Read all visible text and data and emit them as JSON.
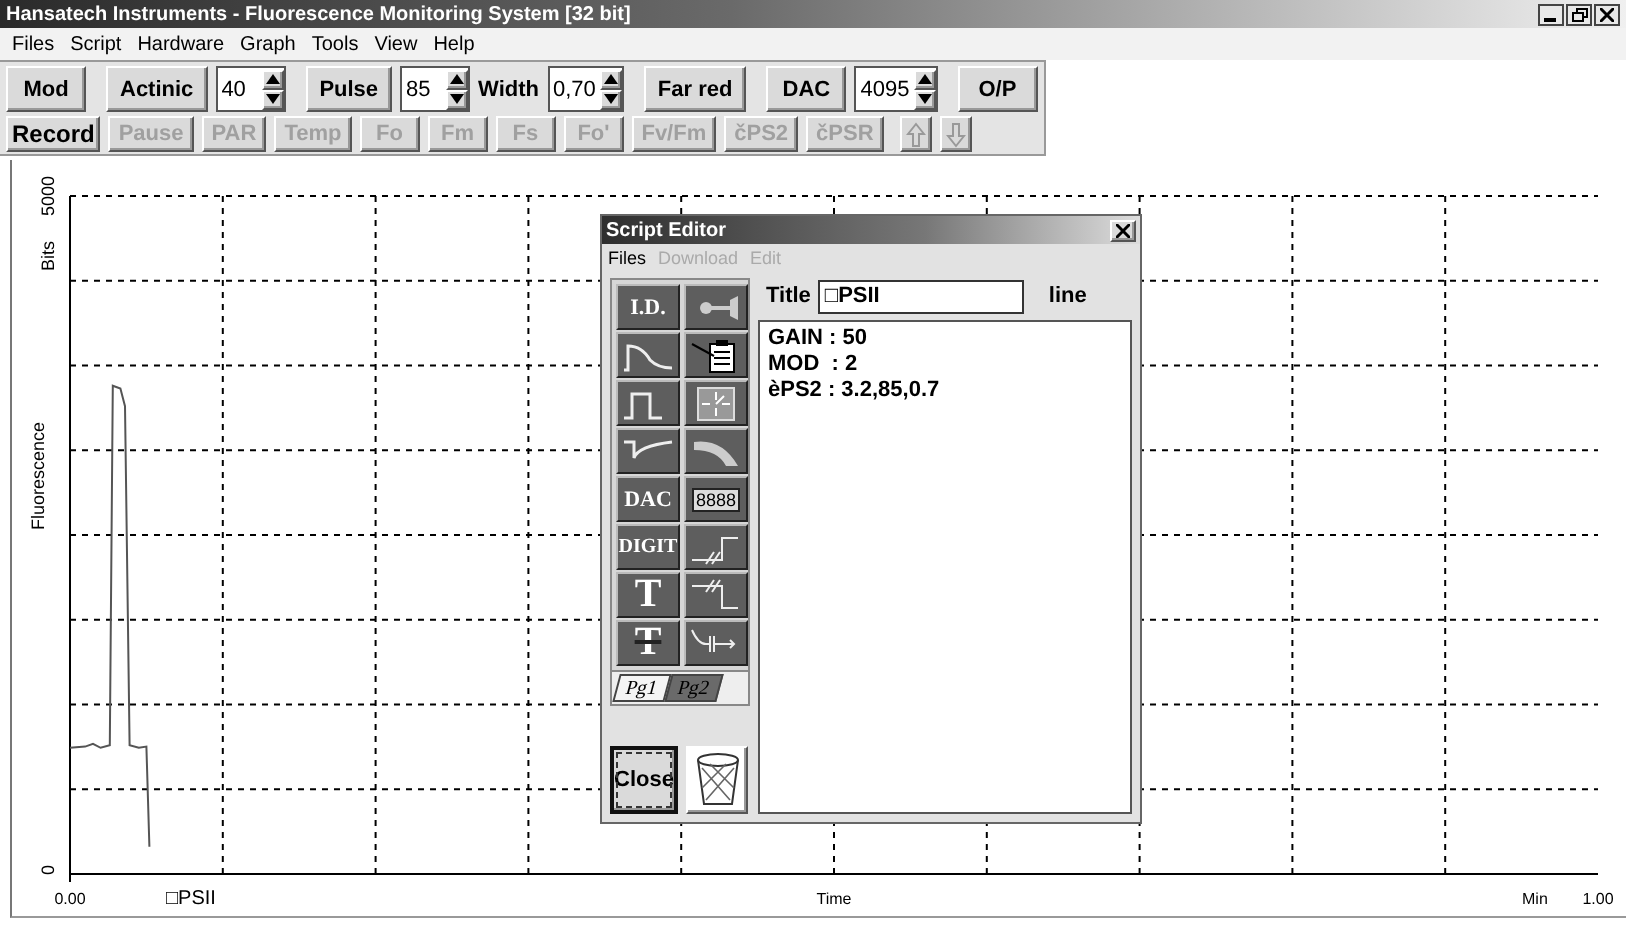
{
  "window": {
    "title": "Hansatech Instruments  -  Fluorescence Monitoring System [32 bit]"
  },
  "menu": [
    "Files",
    "Script",
    "Hardware",
    "Graph",
    "Tools",
    "View",
    "Help"
  ],
  "toolbar_top": [
    {
      "kind": "button",
      "label": "Mod"
    },
    {
      "kind": "spinner",
      "label": "Actinic",
      "value": "40"
    },
    {
      "kind": "spinner",
      "label": "Pulse",
      "value": "85"
    },
    {
      "kind": "labeled-spinner",
      "label": "Width",
      "value": "0,70"
    },
    {
      "kind": "button",
      "label": "Far red"
    },
    {
      "kind": "spinner",
      "label": "DAC",
      "value": "4095"
    },
    {
      "kind": "button",
      "label": "O/P"
    }
  ],
  "toolbar_bottom": [
    {
      "kind": "button",
      "label": "Record",
      "disabled": false
    },
    {
      "kind": "button",
      "label": "Pause",
      "disabled": true
    },
    {
      "kind": "button",
      "label": "PAR",
      "disabled": true
    },
    {
      "kind": "button",
      "label": "Temp",
      "disabled": true
    },
    {
      "kind": "button",
      "label": "Fo",
      "disabled": true
    },
    {
      "kind": "button",
      "label": "Fm",
      "disabled": true
    },
    {
      "kind": "button",
      "label": "Fs",
      "disabled": true
    },
    {
      "kind": "button",
      "label": "Fo'",
      "disabled": true
    },
    {
      "kind": "button",
      "label": "Fv/Fm",
      "disabled": true
    },
    {
      "kind": "button",
      "label": "čPS2",
      "disabled": true
    },
    {
      "kind": "button",
      "label": "čPSR",
      "disabled": true
    },
    {
      "kind": "arrow-up",
      "disabled": true
    },
    {
      "kind": "arrow-down",
      "disabled": true
    }
  ],
  "chart": {
    "x_unit": "Min",
    "y_unit": "Bits",
    "chart_data": {
      "type": "line",
      "xlabel": "Time",
      "ylabel": "Fluorescence",
      "xlim": [
        0,
        1
      ],
      "ylim": [
        0,
        5000
      ],
      "xticks": [
        {
          "value": 0,
          "label": "0.00"
        },
        {
          "value": 1,
          "label": "1.00"
        }
      ],
      "yticks": [
        {
          "value": 0,
          "label": "0"
        },
        {
          "value": 5000,
          "label": "5000"
        }
      ],
      "x": [
        0,
        0.01,
        0.015,
        0.02,
        0.026,
        0.028,
        0.033,
        0.036,
        0.039,
        0.045,
        0.05,
        0.052
      ],
      "series": [
        {
          "name": "□PSII",
          "color": "#555555",
          "values": [
            930,
            940,
            960,
            930,
            950,
            3600,
            3580,
            3450,
            950,
            930,
            940,
            200
          ]
        }
      ]
    }
  },
  "script_editor": {
    "title": "Script Editor",
    "menu": [
      {
        "label": "Files",
        "disabled": false
      },
      {
        "label": "Download",
        "disabled": true
      },
      {
        "label": "Edit",
        "disabled": true
      }
    ],
    "tools": [
      {
        "kind": "text",
        "label": "I.D."
      },
      {
        "kind": "lamp"
      },
      {
        "kind": "decay"
      },
      {
        "kind": "clipboard"
      },
      {
        "kind": "pulse"
      },
      {
        "kind": "clock"
      },
      {
        "kind": "rise"
      },
      {
        "kind": "swoosh"
      },
      {
        "kind": "text",
        "label": "DAC"
      },
      {
        "kind": "display",
        "label": "8888"
      },
      {
        "kind": "text",
        "label": "DIGIT"
      },
      {
        "kind": "step-up"
      },
      {
        "kind": "big-text",
        "label": "T"
      },
      {
        "kind": "step-down"
      },
      {
        "kind": "struck-text",
        "label": "T"
      },
      {
        "kind": "capacitor"
      }
    ],
    "tabs": [
      {
        "label": "Pg1",
        "selected": true
      },
      {
        "label": "Pg2",
        "selected": false
      }
    ],
    "close_button": "Close",
    "title_label": "Title",
    "title_value": "□PSII",
    "line_label": "line",
    "script_lines": [
      "GAIN : 50",
      "MOD  : 2",
      "èPS2 : 3.2,85,0.7"
    ]
  }
}
